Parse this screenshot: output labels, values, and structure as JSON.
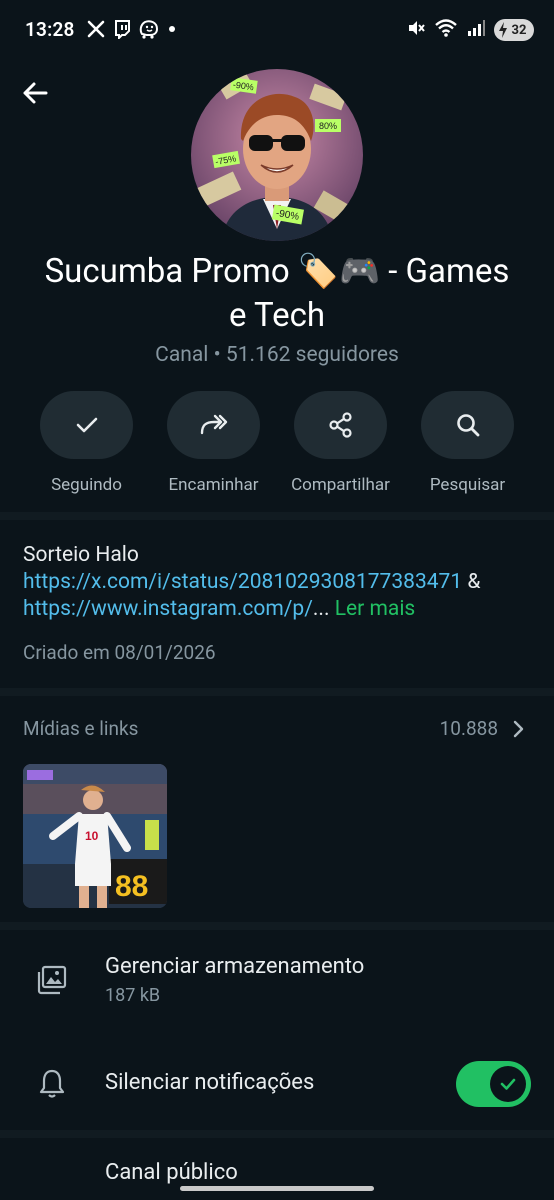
{
  "status_bar": {
    "time": "13:28",
    "left_icons": [
      "x-icon",
      "twitch-icon",
      "waze-icon",
      "dot-icon"
    ],
    "right_icons": [
      "mute-icon",
      "wifi-icon",
      "signal-icon",
      "battery-icon"
    ],
    "battery_level": "32"
  },
  "header": {
    "back_icon": "arrow-left-icon"
  },
  "channel": {
    "title_line1": "Sucumba Promo 🏷️🎮  - Games",
    "title_line2": "e Tech",
    "subtitle": "Canal • 51.162 seguidores",
    "avatar_tags": [
      "-90%",
      "80%",
      "-75%",
      "-90%"
    ]
  },
  "actions": [
    {
      "label": "Seguindo",
      "icon": "check-icon"
    },
    {
      "label": "Encaminhar",
      "icon": "forward-icon"
    },
    {
      "label": "Compartilhar",
      "icon": "share-icon"
    },
    {
      "label": "Pesquisar",
      "icon": "search-icon"
    }
  ],
  "description": {
    "line1": "Sorteio Halo",
    "link1": "https://x.com/i/status/2081029308177383471",
    "amp": " &",
    "link2": "https://www.instagram.com/p/",
    "ellipsis": "... ",
    "more": "Ler mais",
    "created": "Criado em 08/01/2026"
  },
  "media": {
    "title": "Mídias e links",
    "count": "10.888"
  },
  "settings": [
    {
      "title": "Gerenciar armazenamento",
      "subtitle": "187 kB",
      "icon": "storage-icon"
    },
    {
      "title": "Silenciar notificações",
      "icon": "bell-icon",
      "toggle_on": true
    },
    {
      "title": "Canal público",
      "icon": "globe-icon"
    }
  ],
  "colors": {
    "background": "#0b141a",
    "accent_green": "#21c063",
    "link_blue": "#53bdeb",
    "muted_text": "#8696a0"
  }
}
